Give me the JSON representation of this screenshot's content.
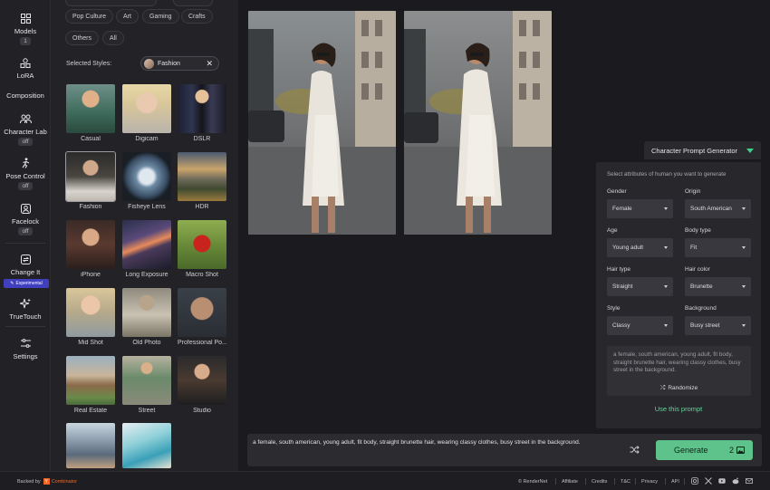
{
  "nav": {
    "models": {
      "label": "Models",
      "badge": "1"
    },
    "lora": {
      "label": "LoRA"
    },
    "composition": {
      "label": "Composition"
    },
    "character_lab": {
      "label": "Character Lab",
      "badge": "off"
    },
    "pose_control": {
      "label": "Pose Control",
      "badge": "off"
    },
    "facelock": {
      "label": "Facelock",
      "badge": "off"
    },
    "change_it": {
      "label": "Change It",
      "badge": "Experimental"
    },
    "truetouch": {
      "label": "TrueTouch"
    },
    "settings": {
      "label": "Settings"
    }
  },
  "styles_panel": {
    "categories": [
      "Pop Culture",
      "Art",
      "Gaming",
      "Crafts",
      "Others",
      "All"
    ],
    "selected_label": "Selected Styles:",
    "selected_chip": "Fashion",
    "tiles": [
      {
        "label": "Casual"
      },
      {
        "label": "Digicam"
      },
      {
        "label": "DSLR"
      },
      {
        "label": "Fashion"
      },
      {
        "label": "Fisheye Lens"
      },
      {
        "label": "HDR"
      },
      {
        "label": "iPhone"
      },
      {
        "label": "Long Exposure"
      },
      {
        "label": "Macro Shot"
      },
      {
        "label": "Mid Shot"
      },
      {
        "label": "Old Photo"
      },
      {
        "label": "Professional Po..."
      },
      {
        "label": "Real Estate"
      },
      {
        "label": "Street"
      },
      {
        "label": "Studio"
      }
    ]
  },
  "generator": {
    "title": "Character Prompt Generator",
    "subtitle": "Select attributes of human you want to generate",
    "fields": {
      "gender": {
        "label": "Gender",
        "value": "Female"
      },
      "origin": {
        "label": "Origin",
        "value": "South American"
      },
      "age": {
        "label": "Age",
        "value": "Young adult"
      },
      "body_type": {
        "label": "Body type",
        "value": "Fit"
      },
      "hair_type": {
        "label": "Hair type",
        "value": "Straight"
      },
      "hair_color": {
        "label": "Hair color",
        "value": "Brunette"
      },
      "style": {
        "label": "Style",
        "value": "Classy"
      },
      "background": {
        "label": "Background",
        "value": "Busy street"
      }
    },
    "preview_text": "a female, south american, young adult, fit body, straight brunette hair, wearing classy clothes, busy street in the background.",
    "randomize_label": "Randomize",
    "use_label": "Use this prompt"
  },
  "prompt": {
    "text": "a female, south american, young adult, fit body, straight brunette hair, wearing classy clothes, busy street in the background.",
    "generate_label": "Generate",
    "count": "2"
  },
  "footer": {
    "backed_by": "Backed by",
    "yc": "Y",
    "combinator": "Combinator",
    "copyright": "© RenderNet",
    "links": [
      "Affiliate",
      "Credits",
      "T&C",
      "Privacy",
      "API"
    ],
    "social_icons": [
      "instagram-icon",
      "x-icon",
      "youtube-icon",
      "reddit-icon",
      "discord-icon",
      "mail-icon"
    ]
  },
  "colors": {
    "accent_green": "#5ec38a",
    "experimental_purple": "#3f3fbf",
    "yc_orange": "#f26522"
  }
}
